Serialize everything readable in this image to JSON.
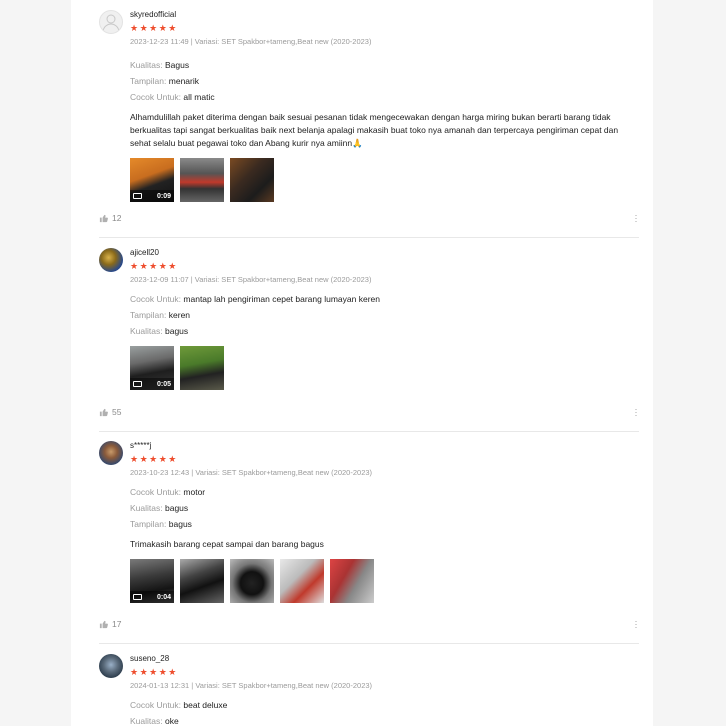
{
  "reviews": [
    {
      "username": "skyredofficial",
      "stars": "★★★★★",
      "meta": "2023-12-23 11:49 | Variasi: SET Spakbor+tameng,Beat new (2020-2023)",
      "attrs": [
        {
          "k": "Kualitas:",
          "v": "Bagus"
        },
        {
          "k": "Tampilan:",
          "v": "menarik"
        },
        {
          "k": "Cocok Untuk:",
          "v": "all matic"
        }
      ],
      "comment": "Alhamdulillah paket diterima dengan baik sesuai pesanan tidak mengecewakan dengan harga miring bukan berarti barang tidak berkualitas tapi sangat berkualitas baik next belanja apalagi makasih buat toko nya amanah dan terpercaya pengiriman cepat dan sehat selalu buat pegawai toko dan Abang kurir nya amiinn🙏",
      "video_duration": "0:09",
      "likes": "12"
    },
    {
      "username": "ajicell20",
      "stars": "★★★★★",
      "meta": "2023-12-09 11:07 | Variasi: SET Spakbor+tameng,Beat new (2020-2023)",
      "attrs": [
        {
          "k": "Cocok Untuk:",
          "v": "mantap lah pengiriman cepet barang lumayan keren"
        },
        {
          "k": "Tampilan:",
          "v": "keren"
        },
        {
          "k": "Kualitas:",
          "v": "bagus"
        }
      ],
      "video_duration": "0:05",
      "likes": "55"
    },
    {
      "username": "s*****j",
      "stars": "★★★★★",
      "meta": "2023-10-23 12:43 | Variasi: SET Spakbor+tameng,Beat new (2020-2023)",
      "attrs": [
        {
          "k": "Cocok Untuk:",
          "v": "motor"
        },
        {
          "k": "Kualitas:",
          "v": "bagus"
        },
        {
          "k": "Tampilan:",
          "v": "bagus"
        }
      ],
      "comment": "Trimakasih barang cepat sampai dan barang bagus",
      "video_duration": "0:04",
      "likes": "17"
    },
    {
      "username": "suseno_28",
      "stars": "★★★★★",
      "meta": "2024-01-13 12:31 | Variasi: SET Spakbor+tameng,Beat new (2020-2023)",
      "attrs": [
        {
          "k": "Cocok Untuk:",
          "v": "beat deluxe"
        },
        {
          "k": "Kualitas:",
          "v": "oke"
        }
      ]
    }
  ],
  "colors": {
    "star": "#ee4d2d",
    "muted": "#9b9b9b"
  },
  "icons": {
    "like": "thumb-up-icon",
    "more": "more-vertical-icon",
    "video": "video-camera-icon"
  }
}
